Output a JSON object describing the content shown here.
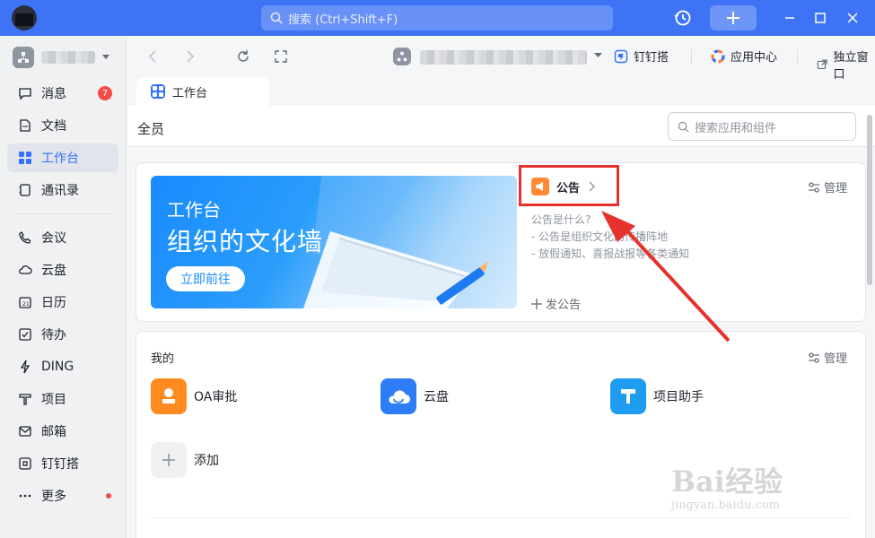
{
  "titlebar": {
    "search_placeholder": "搜索 (Ctrl+Shift+F)"
  },
  "sidebar": {
    "items": [
      {
        "label": "消息",
        "badge": "7"
      },
      {
        "label": "文档"
      },
      {
        "label": "工作台"
      },
      {
        "label": "通讯录"
      },
      {
        "label": "会议"
      },
      {
        "label": "云盘"
      },
      {
        "label": "日历"
      },
      {
        "label": "待办"
      },
      {
        "label": "DING"
      },
      {
        "label": "项目"
      },
      {
        "label": "邮箱"
      },
      {
        "label": "钉钉搭"
      },
      {
        "label": "更多"
      }
    ]
  },
  "toolbar": {
    "links": [
      "钉钉搭",
      "应用中心",
      "独立窗口"
    ]
  },
  "tab": {
    "label": "工作台"
  },
  "content": {
    "title": "全员",
    "search_placeholder": "搜索应用和组件",
    "banner": {
      "title": "工作台",
      "subtitle": "组织的文化墙",
      "button": "立即前往"
    },
    "notice": {
      "title": "公告",
      "question": "公告是什么?",
      "line1": "- 公告是组织文化的传播阵地",
      "line2": "- 放假通知、喜报战报等各类通知",
      "post": "发公告",
      "manage": "管理"
    },
    "mine": {
      "title": "我的",
      "manage": "管理",
      "apps": [
        "OA审批",
        "云盘",
        "项目助手"
      ],
      "add": "添加"
    }
  },
  "watermark": {
    "brand": "Bai经验",
    "url": "jingyan.baidu.com"
  },
  "colors": {
    "accent": "#3370ff",
    "titlebar": "#3e73f5",
    "highlight": "#e5322d"
  }
}
